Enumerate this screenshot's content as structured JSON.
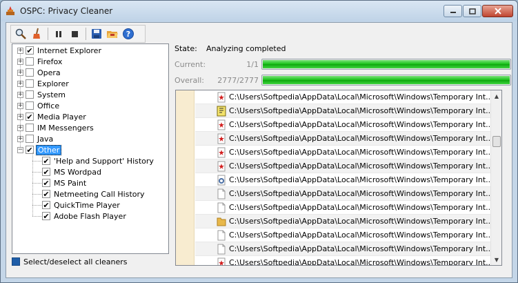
{
  "window": {
    "title": "OSPC: Privacy Cleaner"
  },
  "toolbar": {
    "buttons": [
      {
        "icon": "scan-icon"
      },
      {
        "icon": "clean-broom-icon"
      },
      {
        "icon": "pause-icon"
      },
      {
        "icon": "stop-icon"
      },
      {
        "icon": "save-icon"
      },
      {
        "icon": "open-folder-icon"
      },
      {
        "icon": "help-icon"
      }
    ]
  },
  "tree": {
    "items": [
      {
        "label": "Internet Explorer",
        "checked": true,
        "expander": "+"
      },
      {
        "label": "Firefox",
        "checked": false,
        "expander": "+"
      },
      {
        "label": "Opera",
        "checked": false,
        "expander": "+"
      },
      {
        "label": "Explorer",
        "checked": false,
        "expander": "+"
      },
      {
        "label": "System",
        "checked": false,
        "expander": "+"
      },
      {
        "label": "Office",
        "checked": false,
        "expander": "+"
      },
      {
        "label": "Media Player",
        "checked": true,
        "expander": "+"
      },
      {
        "label": "IM Messengers",
        "checked": false,
        "expander": "+"
      },
      {
        "label": "Java",
        "checked": false,
        "expander": "+"
      },
      {
        "label": "Other",
        "checked": true,
        "expander": "−",
        "selected": true
      }
    ],
    "children": [
      {
        "label": "'Help and Support' History",
        "checked": true
      },
      {
        "label": "MS Wordpad",
        "checked": true
      },
      {
        "label": "MS Paint",
        "checked": true
      },
      {
        "label": "Netmeeting Call History",
        "checked": true
      },
      {
        "label": "QuickTime Player",
        "checked": true
      },
      {
        "label": "Adobe Flash Player",
        "checked": true
      }
    ]
  },
  "select_all": {
    "label": "Select/deselect all cleaners"
  },
  "status": {
    "state_label": "State:",
    "state_value": "Analyzing completed",
    "current_label": "Current:",
    "current_value": "1/1",
    "current_progress": 1.0,
    "overall_label": "Overall:",
    "overall_value": "2777/2777",
    "overall_progress": 1.0
  },
  "files": [
    {
      "icon": "red-file-icon",
      "path": "C:\\Users\\Softpedia\\AppData\\Local\\Microsoft\\Windows\\Temporary Int..."
    },
    {
      "icon": "script-file-icon",
      "path": "C:\\Users\\Softpedia\\AppData\\Local\\Microsoft\\Windows\\Temporary Int..."
    },
    {
      "icon": "red-file-icon",
      "path": "C:\\Users\\Softpedia\\AppData\\Local\\Microsoft\\Windows\\Temporary Int..."
    },
    {
      "icon": "red-file-icon",
      "path": "C:\\Users\\Softpedia\\AppData\\Local\\Microsoft\\Windows\\Temporary Int..."
    },
    {
      "icon": "red-file-icon",
      "path": "C:\\Users\\Softpedia\\AppData\\Local\\Microsoft\\Windows\\Temporary Int..."
    },
    {
      "icon": "red-file-icon",
      "path": "C:\\Users\\Softpedia\\AppData\\Local\\Microsoft\\Windows\\Temporary Int..."
    },
    {
      "icon": "settings-file-icon",
      "path": "C:\\Users\\Softpedia\\AppData\\Local\\Microsoft\\Windows\\Temporary Int..."
    },
    {
      "icon": "blank-file-icon",
      "path": "C:\\Users\\Softpedia\\AppData\\Local\\Microsoft\\Windows\\Temporary Int..."
    },
    {
      "icon": "blank-file-icon",
      "path": "C:\\Users\\Softpedia\\AppData\\Local\\Microsoft\\Windows\\Temporary Int..."
    },
    {
      "icon": "folder-icon",
      "path": "C:\\Users\\Softpedia\\AppData\\Local\\Microsoft\\Windows\\Temporary Int..."
    },
    {
      "icon": "blank-file-icon",
      "path": "C:\\Users\\Softpedia\\AppData\\Local\\Microsoft\\Windows\\Temporary Int..."
    },
    {
      "icon": "blank-file-icon",
      "path": "C:\\Users\\Softpedia\\AppData\\Local\\Microsoft\\Windows\\Temporary Int..."
    },
    {
      "icon": "red-file-icon",
      "path": "C:\\Users\\Softpedia\\AppData\\Local\\Microsoft\\Windows\\Temporary Int..."
    }
  ],
  "colors": {
    "progress_fill": "#16c316",
    "selection": "#3399ff",
    "gutter": "#f8ecd0"
  }
}
